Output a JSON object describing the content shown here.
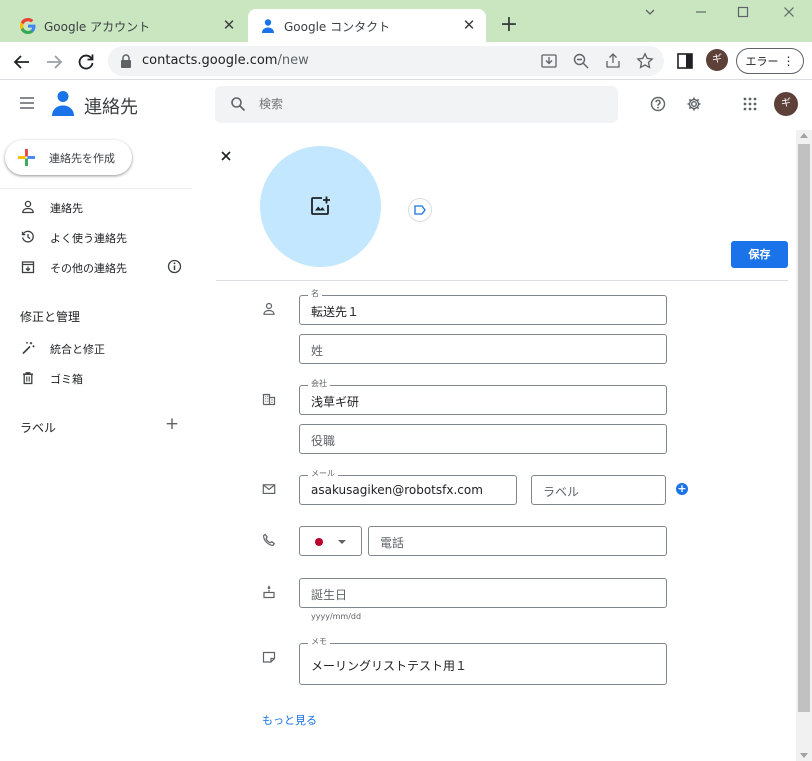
{
  "browser": {
    "tabs": [
      {
        "title": "Google アカウント",
        "favicon": "google-g-icon",
        "active": false
      },
      {
        "title": "Google コンタクト",
        "favicon": "contacts-icon",
        "active": true
      }
    ],
    "url_host": "contacts.google.com",
    "url_path": "/new",
    "profile_initial": "ギ",
    "error_button": "エラー",
    "tab_strip_color": "#c9e6c1"
  },
  "app": {
    "name": "連絡先",
    "search_placeholder": "検索",
    "avatar_initial": "ギ",
    "accent_color": "#1a73e8"
  },
  "sidebar": {
    "create_button": "連絡先を作成",
    "items": [
      {
        "label": "連絡先",
        "icon": "person-icon"
      },
      {
        "label": "よく使う連絡先",
        "icon": "history-icon"
      },
      {
        "label": "その他の連絡先",
        "icon": "archive-icon"
      }
    ],
    "manage_title": "修正と管理",
    "manage_items": [
      {
        "label": "統合と修正",
        "icon": "magic-wand-icon"
      },
      {
        "label": "ゴミ箱",
        "icon": "trash-icon"
      }
    ],
    "labels_title": "ラベル"
  },
  "form": {
    "save_label": "保存",
    "first_name_label": "名",
    "first_name_value": "転送先１",
    "last_name_placeholder": "姓",
    "company_label": "会社",
    "company_value": "浅草ギ研",
    "job_title_placeholder": "役職",
    "email_label": "メール",
    "email_value": "asakusagiken@robotsfx.com",
    "email_label_placeholder": "ラベル",
    "phone_placeholder": "電話",
    "birthday_placeholder": "誕生日",
    "birthday_hint": "yyyy/mm/dd",
    "notes_label": "メモ",
    "notes_value": "メーリングリストテスト用１",
    "more_link": "もっと見る"
  }
}
